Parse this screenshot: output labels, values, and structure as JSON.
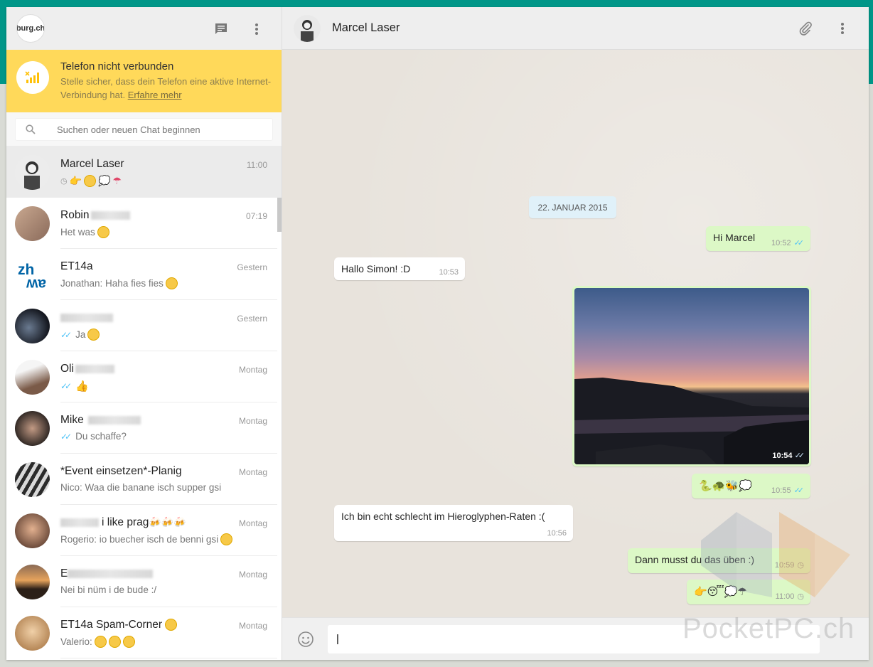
{
  "sidebar": {
    "profile_label": "burg.ch",
    "alert": {
      "title": "Telefon nicht verbunden",
      "text": "Stelle sicher, dass dein Telefon eine aktive Internet-Verbindung hat.",
      "link": "Erfahre mehr"
    },
    "search_placeholder": "Suchen oder neuen Chat beginnen",
    "chats": [
      {
        "name": "Marcel Laser",
        "time": "11:00",
        "last": "",
        "active": true
      },
      {
        "name": "Robin",
        "time": "07:19",
        "last": "Het was"
      },
      {
        "name": "ET14a",
        "time": "Gestern",
        "last": "Jonathan: Haha fies fies"
      },
      {
        "name": "",
        "time": "Gestern",
        "last": "Ja"
      },
      {
        "name": "Oli",
        "time": "Montag",
        "last": ""
      },
      {
        "name": "Mike",
        "time": "Montag",
        "last": "Du schaffe?"
      },
      {
        "name": "*Event einsetzen*-Planig",
        "time": "Montag",
        "last": "Nico: Waa die banane isch supper gsi"
      },
      {
        "name": "i like prag",
        "time": "Montag",
        "last": "Rogerio: io buecher isch de benni gsi"
      },
      {
        "name": "E",
        "time": "Montag",
        "last": "Nei bi nüm i de bude :/"
      },
      {
        "name": "ET14a Spam-Corner",
        "time": "Montag",
        "last": "Valerio:"
      }
    ]
  },
  "conversation": {
    "title": "Marcel Laser",
    "date": "22. JANUAR 2015",
    "messages": [
      {
        "dir": "out",
        "text": "Hi Marcel",
        "time": "10:52"
      },
      {
        "dir": "in",
        "text": "Hallo Simon! :D",
        "time": "10:53"
      },
      {
        "dir": "out",
        "text": "",
        "time": "10:54"
      },
      {
        "dir": "out",
        "text": "",
        "time": "10:55"
      },
      {
        "dir": "in",
        "text": "Ich bin echt schlecht im Hieroglyphen-Raten :(",
        "time": "10:56"
      },
      {
        "dir": "out",
        "text": "Dann musst du das üben :)",
        "time": "10:59"
      },
      {
        "dir": "out",
        "text": "",
        "time": "11:00"
      }
    ]
  },
  "footer": {
    "message_value": "|"
  },
  "watermark": "PocketPC.ch",
  "colors": {
    "accent": "#009688",
    "outgoing": "#dcf8c6",
    "alert": "#ffd95a",
    "tick": "#4fc3f7"
  }
}
